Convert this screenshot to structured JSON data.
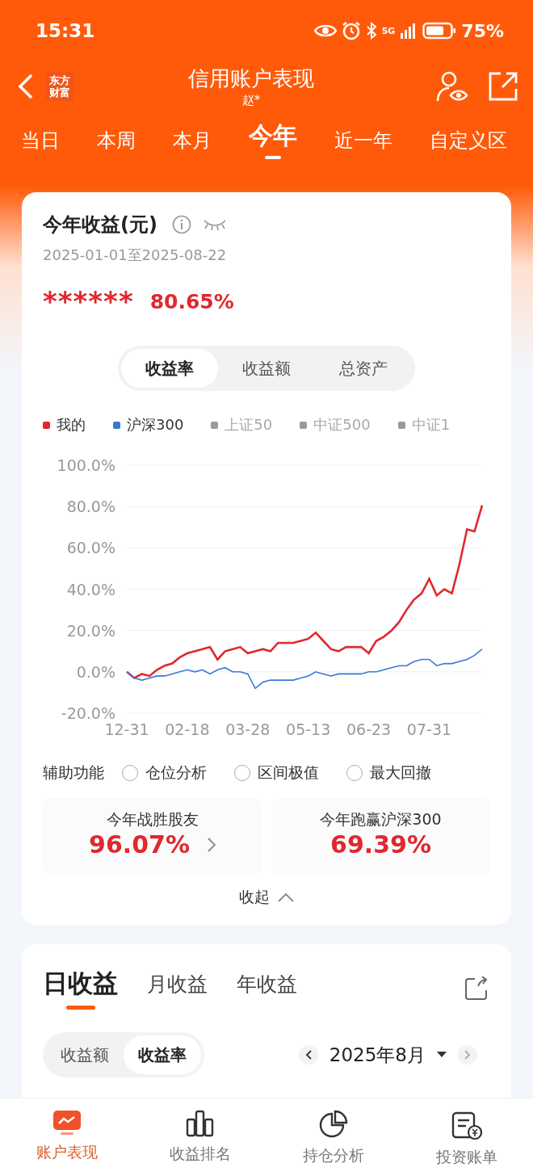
{
  "status_bar": {
    "time": "15:31",
    "network": "5G",
    "battery": "75%"
  },
  "header": {
    "logo_lines": [
      "东方",
      "财富"
    ],
    "title": "信用账户表现",
    "subtitle": "赵*"
  },
  "period_tabs": [
    {
      "label": "当日",
      "selected": false
    },
    {
      "label": "本周",
      "selected": false
    },
    {
      "label": "本月",
      "selected": false
    },
    {
      "label": "今年",
      "selected": true
    },
    {
      "label": "近一年",
      "selected": false
    },
    {
      "label": "自定义区",
      "selected": false
    }
  ],
  "summary": {
    "title": "今年收益(元)",
    "date_range": "2025-01-01至2025-08-22",
    "hidden_amount": "******",
    "rate": "80.65%",
    "segments": [
      {
        "label": "收益率",
        "selected": true
      },
      {
        "label": "收益额",
        "selected": false
      },
      {
        "label": "总资产",
        "selected": false
      }
    ],
    "legend_more": [
      {
        "label": "上证50",
        "color": "#9a9a9a",
        "on": false
      },
      {
        "label": "中证500",
        "color": "#9a9a9a",
        "on": false
      },
      {
        "label": "中证1",
        "color": "#9a9a9a",
        "on": false
      }
    ],
    "chart_data": {
      "type": "line",
      "categories": [
        "12-31",
        null,
        null,
        null,
        null,
        null,
        null,
        null,
        "02-18",
        null,
        null,
        null,
        null,
        null,
        null,
        null,
        "03-28",
        null,
        null,
        null,
        null,
        null,
        null,
        null,
        "05-13",
        null,
        null,
        null,
        null,
        null,
        null,
        null,
        "06-23",
        null,
        null,
        null,
        null,
        null,
        null,
        null,
        "07-31",
        null,
        null,
        null,
        null,
        null,
        null,
        null
      ],
      "series": [
        {
          "name": "我的",
          "color": "#e0282e",
          "values": [
            0,
            -3,
            -1,
            -2,
            1,
            3,
            4,
            7,
            9,
            10,
            11,
            12,
            6,
            10,
            11,
            12,
            9,
            10,
            11,
            10,
            14,
            14,
            14,
            15,
            16,
            19,
            15,
            11,
            10,
            12,
            12,
            12,
            9,
            15,
            17,
            20,
            24,
            30,
            35,
            38,
            45,
            37,
            40,
            38,
            52,
            69,
            68,
            80.6
          ]
        },
        {
          "name": "沪深300",
          "color": "#3a78d8",
          "values": [
            0,
            -3,
            -4,
            -3,
            -2,
            -2,
            -1,
            0,
            1,
            0,
            1,
            -1,
            1,
            2,
            0,
            0,
            -1,
            -8,
            -5,
            -4,
            -4,
            -4,
            -4,
            -3,
            -2,
            0,
            -1,
            -2,
            -1,
            -1,
            -1,
            -1,
            0,
            0,
            1,
            2,
            3,
            3,
            5,
            6,
            6,
            3,
            4,
            4,
            5,
            6,
            8,
            11
          ]
        }
      ],
      "ylim": [
        -20,
        100
      ],
      "grid": true,
      "yticks": [
        {
          "value": 100,
          "label": "100.0%"
        },
        {
          "value": 80,
          "label": "80.0%"
        },
        {
          "value": 60,
          "label": "60.0%"
        },
        {
          "value": 40,
          "label": "40.0%"
        },
        {
          "value": 20,
          "label": "20.0%"
        },
        {
          "value": 0,
          "label": "0.0%"
        },
        {
          "value": -20,
          "label": "-20.0%"
        }
      ]
    },
    "assist_label": "辅助功能",
    "assist_options": [
      {
        "label": "仓位分析",
        "checked": false
      },
      {
        "label": "区间极值",
        "checked": false
      },
      {
        "label": "最大回撤",
        "checked": false
      }
    ],
    "stats": [
      {
        "label": "今年战胜股友",
        "value": "96.07%",
        "has_link": true
      },
      {
        "label": "今年跑赢沪深300",
        "value": "69.39%",
        "has_link": false
      }
    ],
    "collapse": "收起"
  },
  "daily": {
    "tabs": [
      {
        "label": "日收益",
        "selected": true
      },
      {
        "label": "月收益",
        "selected": false
      },
      {
        "label": "年收益",
        "selected": false
      }
    ],
    "segments": [
      {
        "label": "收益额",
        "selected": false
      },
      {
        "label": "收益率",
        "selected": true
      }
    ],
    "month": "2025年8月"
  },
  "bottom_nav": [
    {
      "label": "账户表现",
      "selected": true
    },
    {
      "label": "收益排名",
      "selected": false
    },
    {
      "label": "持仓分析",
      "selected": false
    },
    {
      "label": "投资账单",
      "selected": false
    }
  ]
}
